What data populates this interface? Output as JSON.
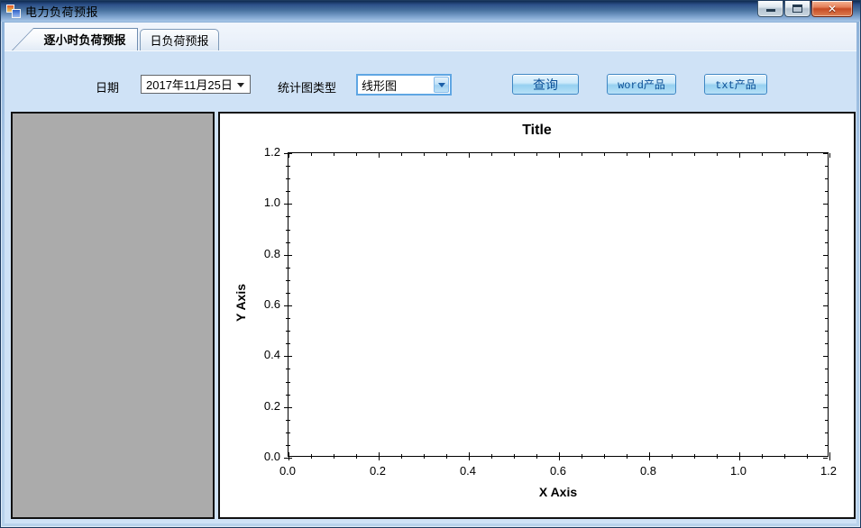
{
  "window": {
    "title": "电力负荷预报",
    "icons": {
      "close_glyph": "✕"
    }
  },
  "tabs": [
    {
      "label": "逐小时负荷预报",
      "selected": true
    },
    {
      "label": "日负荷预报",
      "selected": false
    }
  ],
  "toolbar": {
    "date_label": "日期",
    "date_value": "2017年11月25日",
    "chart_type_label": "统计图类型",
    "chart_type_value": "线形图",
    "query_button": "查询",
    "word_button": "word产品",
    "txt_button": "txt产品"
  },
  "chart_data": {
    "type": "line",
    "title": "Title",
    "xlabel": "X Axis",
    "ylabel": "Y Axis",
    "xlim": [
      0,
      1.2
    ],
    "ylim": [
      0,
      1.2
    ],
    "x_major_ticks": [
      0,
      0.2,
      0.4,
      0.6,
      0.8,
      1.0,
      1.2
    ],
    "y_major_ticks": [
      0,
      0.2,
      0.4,
      0.6,
      0.8,
      1.0,
      1.2
    ],
    "x_tick_labels": [
      "0.0",
      "0.2",
      "0.4",
      "0.6",
      "0.8",
      "1.0",
      "1.2"
    ],
    "y_tick_labels": [
      "0.0",
      "0.2",
      "0.4",
      "0.6",
      "0.8",
      "1.0",
      "1.2"
    ],
    "minor_step": 0.05,
    "grid": false,
    "series": []
  },
  "colors": {
    "tabpage_bg": "#cfe2f6",
    "left_panel_bg": "#ababab",
    "button_border": "#3f87c4",
    "button_text": "#0a4f96",
    "close_button": "#c74b24",
    "combo_focus_border": "#5fa6e3"
  }
}
